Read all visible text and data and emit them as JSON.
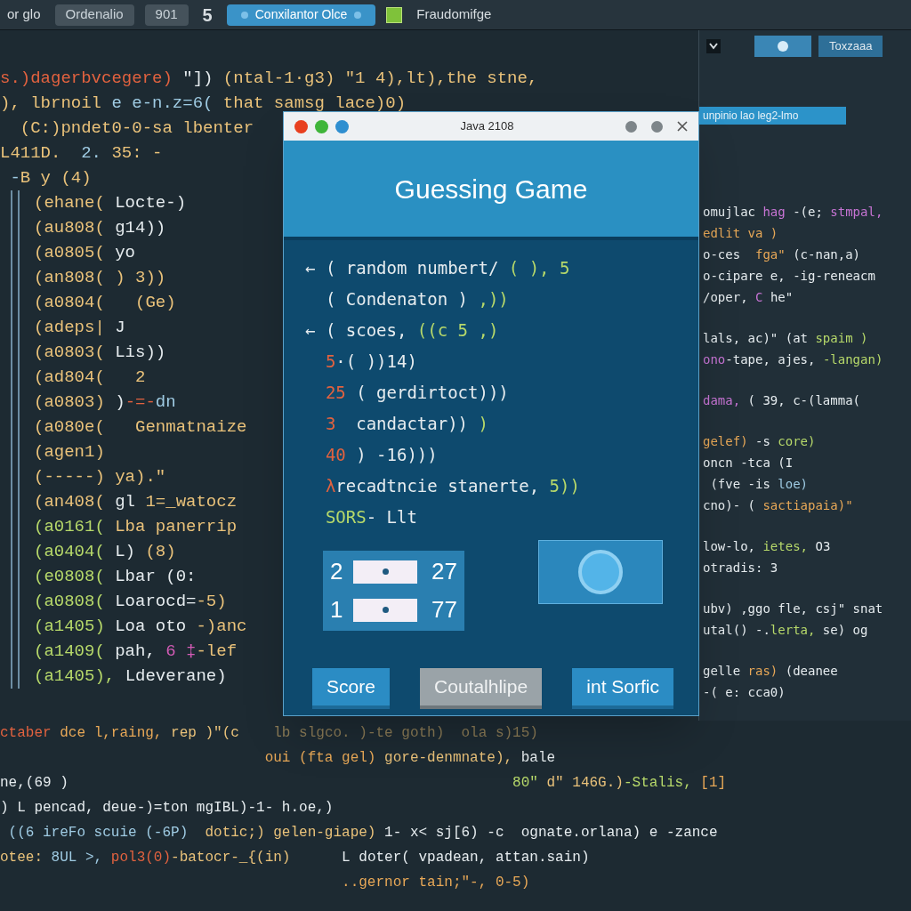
{
  "top_tabs": [
    {
      "label": "or glo",
      "kind": "plain",
      "selected": false
    },
    {
      "label": "Ordenalio",
      "kind": "boxed",
      "selected": false
    },
    {
      "label": "901",
      "kind": "boxed",
      "selected": false
    },
    {
      "label": "5",
      "kind": "plain",
      "selected": false
    },
    {
      "label": "Conxilantor Olce",
      "kind": "boxed",
      "selected": true
    },
    {
      "label": "Fraudomifge",
      "kind": "iconed",
      "selected": false
    }
  ],
  "editor_lines": [
    {
      "guide": false,
      "segs": [
        {
          "text": "s.)dagerbvcegere)",
          "color": "#e2623f"
        },
        {
          "text": " \"]) ",
          "color": "#e6ecef"
        },
        {
          "text": "(ntal-1·g3) \"1 4),lt),the stne,",
          "color": "#eac27a"
        }
      ]
    },
    {
      "guide": false,
      "segs": [
        {
          "text": "), lbrnoil ",
          "color": "#eac27a"
        },
        {
          "text": "e e-n.z=6( ",
          "color": "#9fcbe3"
        },
        {
          "text": "that samsg lace)0)",
          "color": "#eac27a"
        }
      ]
    },
    {
      "guide": false,
      "segs": [
        {
          "text": "  (C:)pndet0-0-sa lbenter",
          "color": "#eac27a"
        }
      ]
    },
    {
      "guide": false,
      "segs": [
        {
          "text": "L411D.  ",
          "color": "#eac27a"
        },
        {
          "text": "2. ",
          "color": "#9fcbe3"
        },
        {
          "text": "35: -",
          "color": "#eac27a"
        }
      ]
    },
    {
      "guide": false,
      "segs": [
        {
          "text": " -",
          "color": "#9fcbe3"
        },
        {
          "text": "B y (4)",
          "color": "#eac27a"
        }
      ]
    },
    {
      "guide": true,
      "segs": [
        {
          "text": "(ehane( ",
          "color": "#eac27a"
        },
        {
          "text": "Locte-)",
          "color": "#e6ecef"
        }
      ]
    },
    {
      "guide": true,
      "segs": [
        {
          "text": "(au808( ",
          "color": "#eac27a"
        },
        {
          "text": "g14))",
          "color": "#e6ecef"
        }
      ]
    },
    {
      "guide": true,
      "segs": [
        {
          "text": "(a0805( ",
          "color": "#eac27a"
        },
        {
          "text": "yo",
          "color": "#e6ecef"
        }
      ]
    },
    {
      "guide": true,
      "segs": [
        {
          "text": "(an808( ",
          "color": "#eac27a"
        },
        {
          "text": ") 3))",
          "color": "#eac27a"
        }
      ]
    },
    {
      "guide": true,
      "segs": [
        {
          "text": "(a0804( ",
          "color": "#eac27a"
        },
        {
          "text": "  (Ge)",
          "color": "#eac27a"
        }
      ]
    },
    {
      "guide": true,
      "segs": [
        {
          "text": "(adeps| ",
          "color": "#eac27a"
        },
        {
          "text": "J",
          "color": "#e6ecef"
        }
      ]
    },
    {
      "guide": true,
      "segs": [
        {
          "text": "(a0803( ",
          "color": "#eac27a"
        },
        {
          "text": "Lis))",
          "color": "#e6ecef"
        }
      ]
    },
    {
      "guide": true,
      "segs": [
        {
          "text": "(ad804( ",
          "color": "#eac27a"
        },
        {
          "text": "  2",
          "color": "#eac27a"
        }
      ]
    },
    {
      "guide": true,
      "segs": [
        {
          "text": "(a0803) ",
          "color": "#eac27a"
        },
        {
          "text": ")",
          "color": "#e6ecef"
        },
        {
          "text": "-=-",
          "color": "#e2623f"
        },
        {
          "text": "dn",
          "color": "#9fcbe3"
        }
      ]
    },
    {
      "guide": true,
      "segs": [
        {
          "text": "(a080e( ",
          "color": "#eac27a"
        },
        {
          "text": "  Genmatnaize",
          "color": "#eac27a"
        }
      ]
    },
    {
      "guide": true,
      "segs": [
        {
          "text": "(agen1)",
          "color": "#eac27a"
        }
      ]
    },
    {
      "guide": true,
      "segs": [
        {
          "text": "(-----) ",
          "color": "#eac27a"
        },
        {
          "text": "ya).\"",
          "color": "#eac27a"
        }
      ]
    },
    {
      "guide": true,
      "segs": [
        {
          "text": "(an408( ",
          "color": "#eac27a"
        },
        {
          "text": "gl ",
          "color": "#e6ecef"
        },
        {
          "text": "1=_watocz",
          "color": "#eac27a"
        }
      ]
    },
    {
      "guide": true,
      "segs": [
        {
          "text": "(a0161( ",
          "color": "#b7d96a"
        },
        {
          "text": "Lba panerrip",
          "color": "#eac27a"
        }
      ]
    },
    {
      "guide": true,
      "segs": [
        {
          "text": "(a0404( ",
          "color": "#b7d96a"
        },
        {
          "text": "L) ",
          "color": "#e6ecef"
        },
        {
          "text": "(8)",
          "color": "#eac27a"
        }
      ]
    },
    {
      "guide": true,
      "segs": [
        {
          "text": "(e0808( ",
          "color": "#b7d96a"
        },
        {
          "text": "Lbar (0:",
          "color": "#e6ecef"
        }
      ]
    },
    {
      "guide": true,
      "segs": [
        {
          "text": "(a0808( ",
          "color": "#b7d96a"
        },
        {
          "text": "Loarocd=",
          "color": "#e6ecef"
        },
        {
          "text": "-5)",
          "color": "#eac27a"
        }
      ]
    },
    {
      "guide": true,
      "segs": [
        {
          "text": "(a1405) ",
          "color": "#b7d96a"
        },
        {
          "text": "Loa oto ",
          "color": "#e6ecef"
        },
        {
          "text": "-)anc",
          "color": "#eac27a"
        }
      ]
    },
    {
      "guide": true,
      "segs": [
        {
          "text": "(a1409( ",
          "color": "#b7d96a"
        },
        {
          "text": "pah, ",
          "color": "#e6ecef"
        },
        {
          "text": "6 ‡",
          "color": "#d25bb5"
        },
        {
          "text": "-lef",
          "color": "#eac27a"
        }
      ]
    },
    {
      "guide": true,
      "segs": [
        {
          "text": "(a1405), ",
          "color": "#b7d96a"
        },
        {
          "text": "Ldeverane)",
          "color": "#e6ecef"
        }
      ]
    }
  ],
  "right_panel": {
    "tabs": [
      {
        "label": "Toxzaaa",
        "selected": false
      }
    ],
    "header": "unpinio lao leg2-lmo",
    "blocks": [
      {
        "lines": [
          {
            "segs": [
              {
                "text": "omujlac ",
                "color": "#e6ecef"
              },
              {
                "text": "hag",
                "color": "#c774d4"
              },
              {
                "text": " -(e; ",
                "color": "#e6ecef"
              },
              {
                "text": "stmpal,",
                "color": "#c774d4"
              }
            ]
          },
          {
            "segs": [
              {
                "text": "edlit va )",
                "color": "#e8a857"
              }
            ]
          },
          {
            "segs": [
              {
                "text": "o-ces  ",
                "color": "#e6ecef"
              },
              {
                "text": "fga\"",
                "color": "#e8a857"
              },
              {
                "text": " (c-nan,a)",
                "color": "#e6ecef"
              }
            ]
          },
          {
            "segs": [
              {
                "text": "o-cipare e, -ig-reneacm",
                "color": "#e6ecef"
              }
            ]
          },
          {
            "segs": [
              {
                "text": "/oper, ",
                "color": "#e6ecef"
              },
              {
                "text": "C",
                "color": "#c774d4"
              },
              {
                "text": " he\"",
                "color": "#e6ecef"
              }
            ]
          }
        ]
      },
      {
        "lines": [
          {
            "segs": [
              {
                "text": "lals, ac)\" (at ",
                "color": "#e6ecef"
              },
              {
                "text": "spaim )",
                "color": "#b7d96a"
              }
            ]
          },
          {
            "segs": [
              {
                "text": "ono",
                "color": "#c774d4"
              },
              {
                "text": "-tape, ajes, ",
                "color": "#e6ecef"
              },
              {
                "text": "-langan)",
                "color": "#b7d96a"
              }
            ]
          }
        ]
      },
      {
        "lines": [
          {
            "segs": [
              {
                "text": "dama,",
                "color": "#c774d4"
              },
              {
                "text": " ( 39, c-(lamma(",
                "color": "#e6ecef"
              }
            ]
          }
        ]
      },
      {
        "lines": [
          {
            "segs": [
              {
                "text": "gelef)",
                "color": "#e8a857"
              },
              {
                "text": " -s ",
                "color": "#e6ecef"
              },
              {
                "text": "core)",
                "color": "#b7d96a"
              }
            ]
          },
          {
            "segs": [
              {
                "text": "oncn -tca (I",
                "color": "#e6ecef"
              }
            ]
          },
          {
            "segs": [
              {
                "text": " (fve -is ",
                "color": "#e6ecef"
              },
              {
                "text": "loe)",
                "color": "#9fcbe3"
              }
            ]
          },
          {
            "segs": [
              {
                "text": "cno)- ( ",
                "color": "#e6ecef"
              },
              {
                "text": "sactiapaia)\"",
                "color": "#e8a857"
              }
            ]
          }
        ]
      },
      {
        "lines": [
          {
            "segs": [
              {
                "text": "low-lo, ",
                "color": "#e6ecef"
              },
              {
                "text": "ietes, ",
                "color": "#b7d96a"
              },
              {
                "text": "O3",
                "color": "#e6ecef"
              }
            ]
          },
          {
            "segs": [
              {
                "text": "otradis: 3",
                "color": "#e6ecef"
              }
            ]
          }
        ]
      },
      {
        "lines": [
          {
            "segs": [
              {
                "text": "ubv) ,ggo fle, csj\" snat",
                "color": "#e6ecef"
              }
            ]
          },
          {
            "segs": [
              {
                "text": "utal() -.",
                "color": "#e6ecef"
              },
              {
                "text": "lerta,",
                "color": "#b7d96a"
              },
              {
                "text": " se) og",
                "color": "#e6ecef"
              }
            ]
          }
        ]
      },
      {
        "lines": [
          {
            "segs": [
              {
                "text": "gelle ",
                "color": "#e6ecef"
              },
              {
                "text": "ras)",
                "color": "#e8a857"
              },
              {
                "text": " (deanee",
                "color": "#e6ecef"
              }
            ]
          },
          {
            "segs": [
              {
                "text": "-( e: cca0)",
                "color": "#e6ecef"
              }
            ]
          }
        ]
      }
    ]
  },
  "bottom_lines": [
    {
      "segs": [
        {
          "text": "ctaber ",
          "color": "#e2623f"
        },
        {
          "text": "dce l,raing, ",
          "color": "#e8a857"
        },
        {
          "text": "rep )\"(c    ",
          "color": "#eac27a"
        },
        {
          "text": "lb slgco. )-te goth)  ola s)15)",
          "color": "#8a7a55"
        }
      ]
    },
    {
      "segs": [
        {
          "text": "                               oui (fta gel) ",
          "color": "#e8a857"
        },
        {
          "text": "gore-denmnate), ",
          "color": "#eac27a"
        },
        {
          "text": "bale",
          "color": "#e6ecef"
        }
      ]
    },
    {
      "segs": [
        {
          "text": "ne,(69 )",
          "color": "#e6ecef"
        },
        {
          "text": "                                                    80\" ",
          "color": "#b7d96a"
        },
        {
          "text": "d\" 146G.)",
          "color": "#eac27a"
        },
        {
          "text": "-Stalis, ",
          "color": "#b7d96a"
        },
        {
          "text": "[1]",
          "color": "#e8a857"
        }
      ]
    },
    {
      "segs": [
        {
          "text": ") L pencad, deue-)=ton mgIBL)-1- h.oe,)",
          "color": "#e6ecef"
        }
      ]
    },
    {
      "segs": [
        {
          "text": " ((6 ireFo scuie (-6P)  ",
          "color": "#9fcbe3"
        },
        {
          "text": "dotic;) gelen-giape) ",
          "color": "#eac27a"
        },
        {
          "text": "1- x< sj[6) -c  ",
          "color": "#e6ecef"
        },
        {
          "text": "ognate.orlana) e -zance",
          "color": "#e6ecef"
        }
      ]
    },
    {
      "segs": [
        {
          "text": "otee: ",
          "color": "#eac27a"
        },
        {
          "text": "8UL >, ",
          "color": "#9fcbe3"
        },
        {
          "text": "pol3(0)",
          "color": "#e2623f"
        },
        {
          "text": "-batocr-_{(in)      ",
          "color": "#eac27a"
        },
        {
          "text": "L doter( vpadean, attan.sain)",
          "color": "#e6ecef"
        }
      ]
    },
    {
      "segs": [
        {
          "text": "                                        ..gernor tain;\"-, 0-5)",
          "color": "#e8a857"
        }
      ]
    }
  ],
  "dialog": {
    "title": "Java 2108",
    "heading": "Guessing Game",
    "lines": [
      {
        "segs": [
          {
            "text": "← ( random numbert/ ",
            "color": "#e6ecef"
          },
          {
            "text": "( ), 5",
            "color": "#b7d96a"
          }
        ]
      },
      {
        "segs": [
          {
            "text": "  ( Condenaton ) ",
            "color": "#e6ecef"
          },
          {
            "text": ",))",
            "color": "#b7d96a"
          }
        ]
      },
      {
        "segs": [
          {
            "text": "← ( scoes, ",
            "color": "#e6ecef"
          },
          {
            "text": "((c 5 ,)",
            "color": "#b7d96a"
          }
        ]
      },
      {
        "segs": [
          {
            "text": "  5",
            "color": "#e2623f"
          },
          {
            "text": "·( ))14)",
            "color": "#e6ecef"
          }
        ]
      },
      {
        "segs": [
          {
            "text": "  25",
            "color": "#e2623f"
          },
          {
            "text": " ( gerdirtoct)))",
            "color": "#e6ecef"
          }
        ]
      },
      {
        "segs": [
          {
            "text": "  3",
            "color": "#e2623f"
          },
          {
            "text": "  candactar)) ",
            "color": "#e6ecef"
          },
          {
            "text": ")",
            "color": "#b7d96a"
          }
        ]
      },
      {
        "segs": [
          {
            "text": "  40",
            "color": "#e2623f"
          },
          {
            "text": " ) -16)))",
            "color": "#e6ecef"
          }
        ]
      },
      {
        "segs": [
          {
            "text": "  λ",
            "color": "#e2623f"
          },
          {
            "text": "recadtncie stanerte, ",
            "color": "#e6ecef"
          },
          {
            "text": "5))",
            "color": "#b7d96a"
          }
        ]
      },
      {
        "segs": [
          {
            "text": "  SORS",
            "color": "#b7d96a"
          },
          {
            "text": "- Llt",
            "color": "#e6ecef"
          }
        ]
      }
    ],
    "guesses": [
      {
        "label": "2",
        "value": "27"
      },
      {
        "label": "1",
        "value": "77"
      }
    ],
    "buttons": [
      {
        "label": "Score",
        "kind": "primary"
      },
      {
        "label": "Coutalhlipe",
        "kind": "secondary"
      },
      {
        "label": "int Sorfic",
        "kind": "primary"
      }
    ]
  }
}
